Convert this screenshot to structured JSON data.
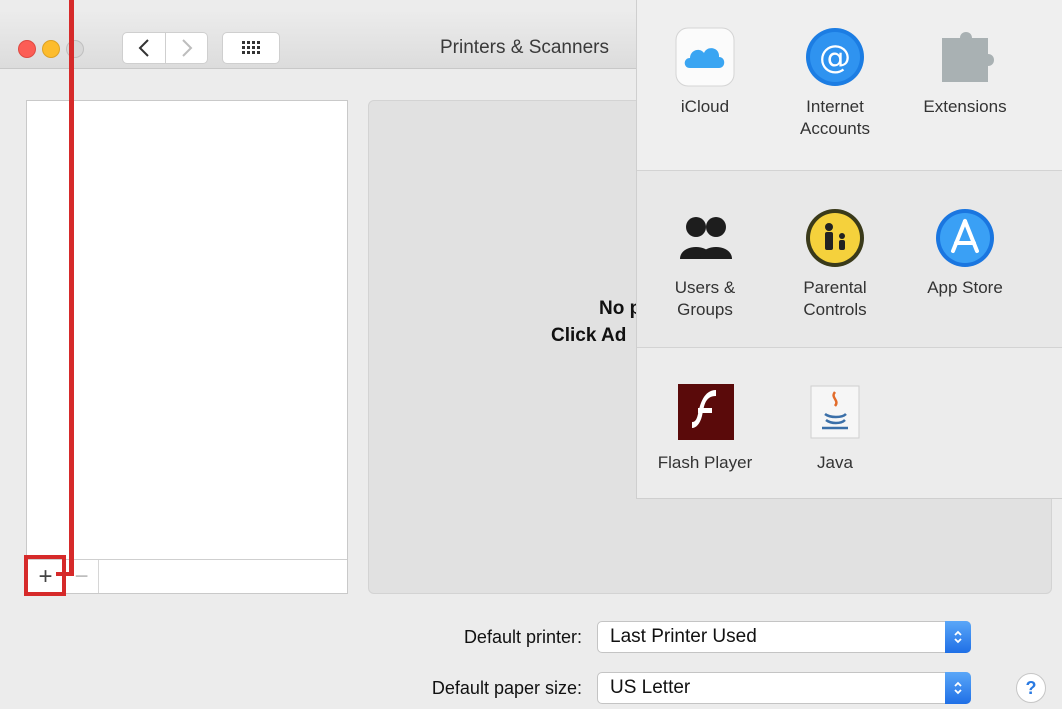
{
  "window": {
    "title": "Printers & Scanners",
    "back_glyph": "<",
    "forward_glyph": ">"
  },
  "printer_list": {
    "add_glyph": "+",
    "remove_glyph": "−"
  },
  "detail": {
    "empty_line1": "No pr",
    "empty_line2": "Click Ad"
  },
  "defaults": {
    "printer_label": "Default printer:",
    "printer_value": "Last Printer Used",
    "paper_label": "Default paper size:",
    "paper_value": "US Letter",
    "help_glyph": "?"
  },
  "preferences": {
    "row1": [
      {
        "label_lines": [
          "iCloud"
        ],
        "icon": "icloud-icon"
      },
      {
        "label_lines": [
          "Internet",
          "Accounts"
        ],
        "icon": "internet-accounts-icon"
      },
      {
        "label_lines": [
          "Extensions"
        ],
        "icon": "extensions-icon"
      }
    ],
    "row2": [
      {
        "label_lines": [
          "Users &",
          "Groups"
        ],
        "icon": "users-groups-icon"
      },
      {
        "label_lines": [
          "Parental",
          "Controls"
        ],
        "icon": "parental-controls-icon"
      },
      {
        "label_lines": [
          "App Store"
        ],
        "icon": "app-store-icon"
      }
    ],
    "row3": [
      {
        "label_lines": [
          "Flash Player"
        ],
        "icon": "flash-player-icon"
      },
      {
        "label_lines": [
          "Java"
        ],
        "icon": "java-icon"
      }
    ]
  },
  "colors": {
    "accent": "#1f6fe6",
    "annotation": "#d62a2a"
  }
}
